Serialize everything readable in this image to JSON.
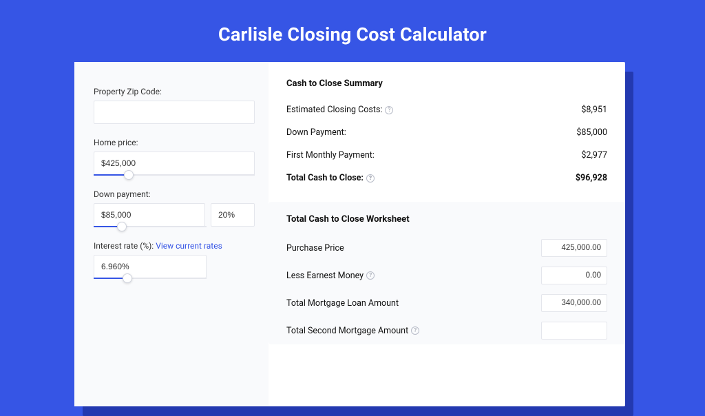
{
  "page_title": "Carlisle Closing Cost Calculator",
  "left": {
    "zip_label": "Property Zip Code:",
    "zip_value": "",
    "home_price_label": "Home price:",
    "home_price_value": "$425,000",
    "home_price_slider_pct": 22,
    "down_payment_label": "Down payment:",
    "down_payment_value": "$85,000",
    "down_payment_pct": "20%",
    "down_payment_slider_pct": 25,
    "interest_label_prefix": "Interest rate (%): ",
    "interest_link_text": "View current rates",
    "interest_value": "6.960%",
    "interest_slider_pct": 30
  },
  "summary": {
    "title": "Cash to Close Summary",
    "rows": [
      {
        "label": "Estimated Closing Costs:",
        "help": true,
        "value": "$8,951",
        "bold": false
      },
      {
        "label": "Down Payment:",
        "help": false,
        "value": "$85,000",
        "bold": false
      },
      {
        "label": "First Monthly Payment:",
        "help": false,
        "value": "$2,977",
        "bold": false
      },
      {
        "label": "Total Cash to Close:",
        "help": true,
        "value": "$96,928",
        "bold": true
      }
    ]
  },
  "worksheet": {
    "title": "Total Cash to Close Worksheet",
    "rows": [
      {
        "label": "Purchase Price",
        "help": false,
        "value": "425,000.00"
      },
      {
        "label": "Less Earnest Money",
        "help": true,
        "value": "0.00"
      },
      {
        "label": "Total Mortgage Loan Amount",
        "help": false,
        "value": "340,000.00"
      },
      {
        "label": "Total Second Mortgage Amount",
        "help": true,
        "value": ""
      }
    ]
  }
}
